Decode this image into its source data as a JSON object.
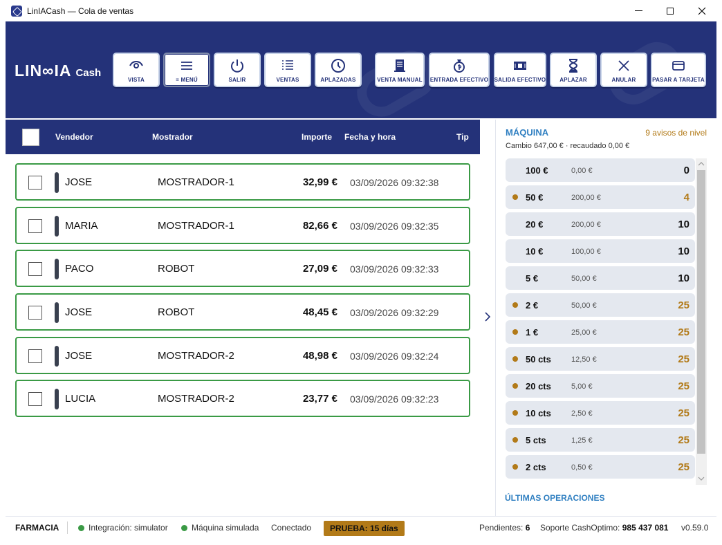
{
  "window": {
    "title": "LinIACash — Cola de ventas"
  },
  "header": {
    "logo_main": "LIN∞IA",
    "logo_sub": "Cash",
    "buttons": [
      {
        "label": "VISTA",
        "icon": "eye-icon"
      },
      {
        "label": "≡ MENÚ",
        "icon": "menu-icon"
      },
      {
        "label": "SALIR",
        "icon": "power-icon"
      },
      {
        "label": "VENTAS",
        "icon": "list-icon"
      },
      {
        "label": "APLAZADAS",
        "icon": "clock-icon"
      },
      {
        "label": "VENTA MANUAL",
        "icon": "receipt-icon"
      },
      {
        "label": "ENTRADA EFECTIVO",
        "icon": "money-bag-icon"
      },
      {
        "label": "SALIDA EFECTIVO",
        "icon": "cash-out-icon"
      },
      {
        "label": "APLAZAR",
        "icon": "hourglass-icon"
      },
      {
        "label": "ANULAR",
        "icon": "x-icon"
      },
      {
        "label": "PASAR A TARJETA",
        "icon": "card-icon"
      }
    ]
  },
  "table": {
    "headers": {
      "vendedor": "Vendedor",
      "mostrador": "Mostrador",
      "importe": "Importe",
      "fecha": "Fecha y hora",
      "tipo": "Tip"
    },
    "rows": [
      {
        "vendedor": "JOSE",
        "mostrador": "MOSTRADOR-1",
        "importe": "32,99 €",
        "fecha": "03/09/2026 09:32:38"
      },
      {
        "vendedor": "MARIA",
        "mostrador": "MOSTRADOR-1",
        "importe": "82,66 €",
        "fecha": "03/09/2026 09:32:35"
      },
      {
        "vendedor": "PACO",
        "mostrador": "ROBOT",
        "importe": "27,09 €",
        "fecha": "03/09/2026 09:32:33"
      },
      {
        "vendedor": "JOSE",
        "mostrador": "ROBOT",
        "importe": "48,45 €",
        "fecha": "03/09/2026 09:32:29"
      },
      {
        "vendedor": "JOSE",
        "mostrador": "MOSTRADOR-2",
        "importe": "48,98 €",
        "fecha": "03/09/2026 09:32:24"
      },
      {
        "vendedor": "LUCIA",
        "mostrador": "MOSTRADOR-2",
        "importe": "23,77 €",
        "fecha": "03/09/2026 09:32:23"
      }
    ]
  },
  "machine": {
    "title": "MÁQUINA",
    "warnings": "9 avisos de nivel",
    "info": "Cambio 647,00 € · recaudado 0,00 €",
    "denominations": [
      {
        "label": "100 €",
        "amount": "0,00 €",
        "count": "0",
        "warn": false
      },
      {
        "label": "50 €",
        "amount": "200,00 €",
        "count": "4",
        "warn": true
      },
      {
        "label": "20 €",
        "amount": "200,00 €",
        "count": "10",
        "warn": false
      },
      {
        "label": "10 €",
        "amount": "100,00 €",
        "count": "10",
        "warn": false
      },
      {
        "label": "5 €",
        "amount": "50,00 €",
        "count": "10",
        "warn": false
      },
      {
        "label": "2 €",
        "amount": "50,00 €",
        "count": "25",
        "warn": true
      },
      {
        "label": "1 €",
        "amount": "25,00 €",
        "count": "25",
        "warn": true
      },
      {
        "label": "50 cts",
        "amount": "12,50 €",
        "count": "25",
        "warn": true
      },
      {
        "label": "20 cts",
        "amount": "5,00 €",
        "count": "25",
        "warn": true
      },
      {
        "label": "10 cts",
        "amount": "2,50 €",
        "count": "25",
        "warn": true
      },
      {
        "label": "5 cts",
        "amount": "1,25 €",
        "count": "25",
        "warn": true
      },
      {
        "label": "2 cts",
        "amount": "0,50 €",
        "count": "25",
        "warn": true
      }
    ],
    "last_ops_title": "ÚLTIMAS OPERACIONES"
  },
  "status": {
    "pharmacy": "FARMACIA",
    "integration": "Integración: simulator",
    "machine": "Máquina simulada",
    "connection": "Conectado",
    "trial": "PRUEBA: 15 días",
    "pending_label": "Pendientes:",
    "pending_value": "6",
    "support_label": "Soporte CashOptimo:",
    "support_phone": "985 437 081",
    "version": "v0.59.0"
  },
  "colors": {
    "header": "#243279",
    "accent": "#2f7fc1",
    "warning": "#b27a18",
    "row_border": "#3a9a45"
  }
}
